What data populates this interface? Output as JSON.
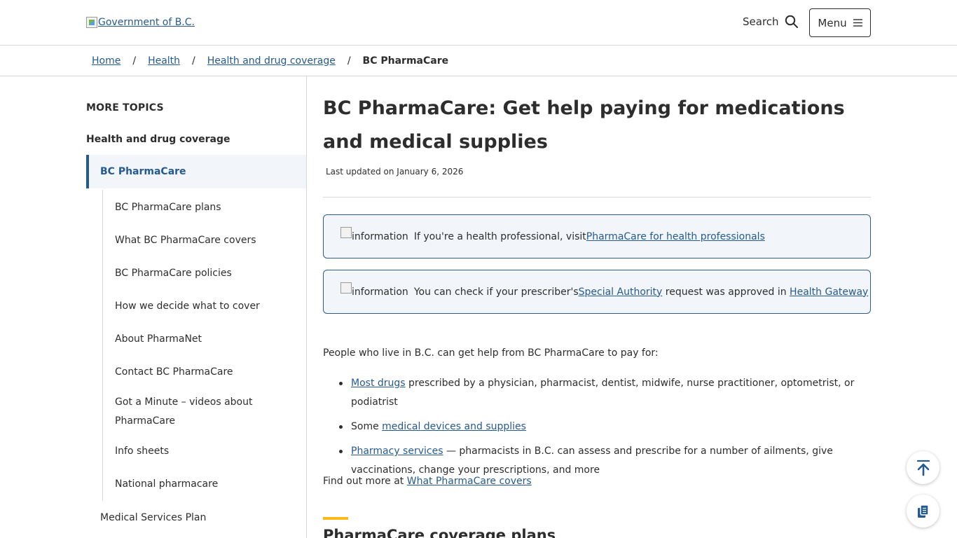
{
  "header": {
    "logo_alt": "Government of B.C.",
    "search_label": "Search",
    "menu_label": "Menu"
  },
  "breadcrumb": {
    "items": [
      "Home",
      "Health",
      "Health and drug coverage"
    ],
    "separator": "/",
    "current": "BC PharmaCare"
  },
  "sidebar": {
    "heading": "MORE TOPICS",
    "parent": "Health and drug coverage",
    "active": "BC PharmaCare",
    "items": [
      "BC PharmaCare plans",
      "What BC PharmaCare covers",
      "BC PharmaCare policies",
      "How we decide what to cover",
      "About PharmaNet",
      "Contact BC PharmaCare",
      "Got a Minute – videos about PharmaCare",
      "Info sheets",
      "National pharmacare"
    ],
    "next_section": "Medical Services Plan"
  },
  "main": {
    "title": "BC PharmaCare: Get help paying for medications and medical supplies",
    "updated": "Last updated on January 6, 2026",
    "info1": {
      "icon_alt": "information",
      "text": "If you're a health professional, visit ",
      "link": "PharmaCare for health professionals"
    },
    "info2": {
      "icon_alt": "information",
      "text_before": "You can check if your prescriber's ",
      "link1": "Special Authority",
      "text_middle": " request was approved in ",
      "link2": "Health Gateway"
    },
    "intro": "People who live in B.C. can get help from BC PharmaCare to pay for:",
    "bullets": [
      {
        "link": "Most drugs",
        "text": " prescribed by a physician, pharmacist, dentist, midwife, nurse practitioner, optometrist, or podiatrist",
        "prefix": ""
      },
      {
        "prefix": "Some ",
        "link": "medical devices and supplies",
        "text": ""
      },
      {
        "prefix": "",
        "link": "Pharmacy services",
        "text": " — pharmacists in B.C. can assess and prescribe for a number of ailments, give vaccinations, change your prescriptions, and more"
      }
    ],
    "find_more_text": "Find out more at ",
    "find_more_link": "What PharmaCare covers",
    "section_heading": "PharmaCare coverage plans"
  },
  "colors": {
    "link": "#255a90",
    "accent": "#fcba19",
    "info_bg": "#f2f6fa",
    "info_border": "#2e5d87"
  },
  "icons": {
    "search": "search-icon",
    "menu": "hamburger-icon",
    "top": "arrow-up-icon",
    "copy": "copy-icon"
  }
}
